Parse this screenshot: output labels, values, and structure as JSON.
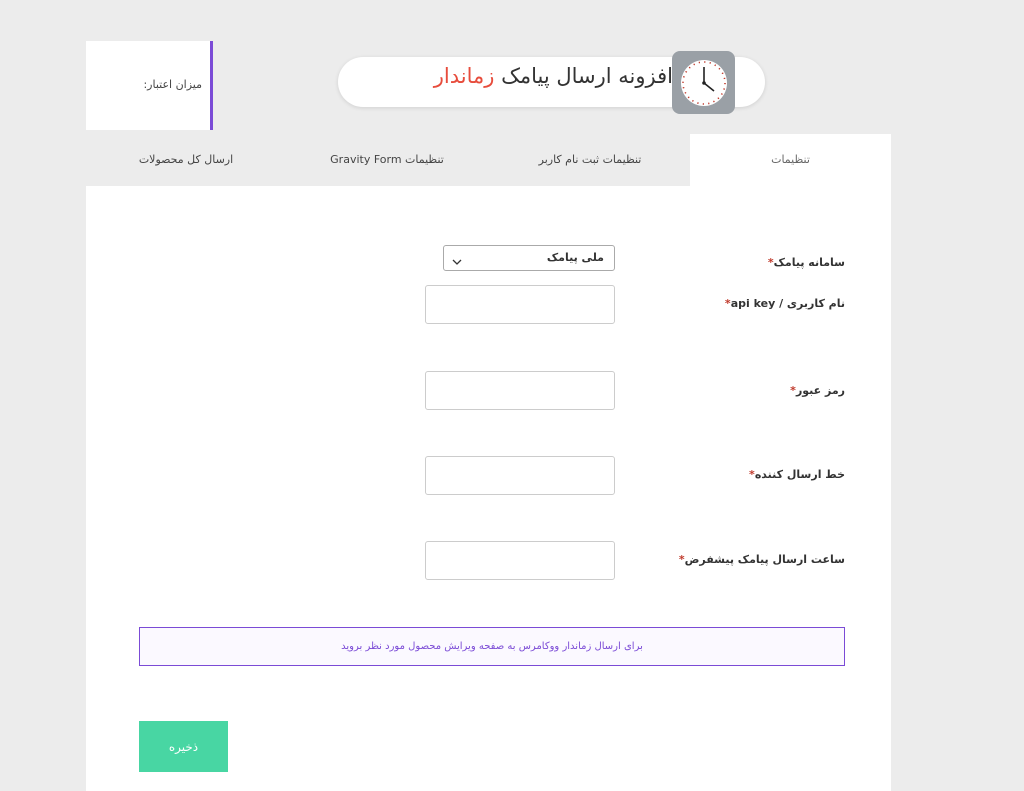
{
  "credit": {
    "label": "میزان اعتبار:"
  },
  "header": {
    "title_main": "افزونه ارسال پیامک",
    "title_accent": "زماندار"
  },
  "tabs": [
    {
      "label": "تنظیمات"
    },
    {
      "label": "تنظیمات ثبت نام کاربر"
    },
    {
      "label": "تنظیمات Gravity Form"
    },
    {
      "label": "ارسال کل محصولات"
    }
  ],
  "form": {
    "sms_system": {
      "label": "سامانه پیامک",
      "required": "*",
      "selected": "ملی پیامک"
    },
    "username": {
      "label": "نام کاربری / api key",
      "required": "*",
      "value": ""
    },
    "password": {
      "label": "رمز عبور",
      "required": "*",
      "value": ""
    },
    "sender_line": {
      "label": "خط ارسال کننده",
      "required": "*",
      "value": ""
    },
    "default_time": {
      "label": "ساعت ارسال پیامک پیشفرض",
      "required": "*",
      "value": ""
    }
  },
  "notice": {
    "text": "برای ارسال زماندار ووکامرس به صفحه ویرایش محصول مورد نظر بروید"
  },
  "save": {
    "label": "ذخیره"
  },
  "colors": {
    "accent": "#7b4bd6",
    "title_accent": "#e74c3c",
    "save": "#48d6a3"
  }
}
